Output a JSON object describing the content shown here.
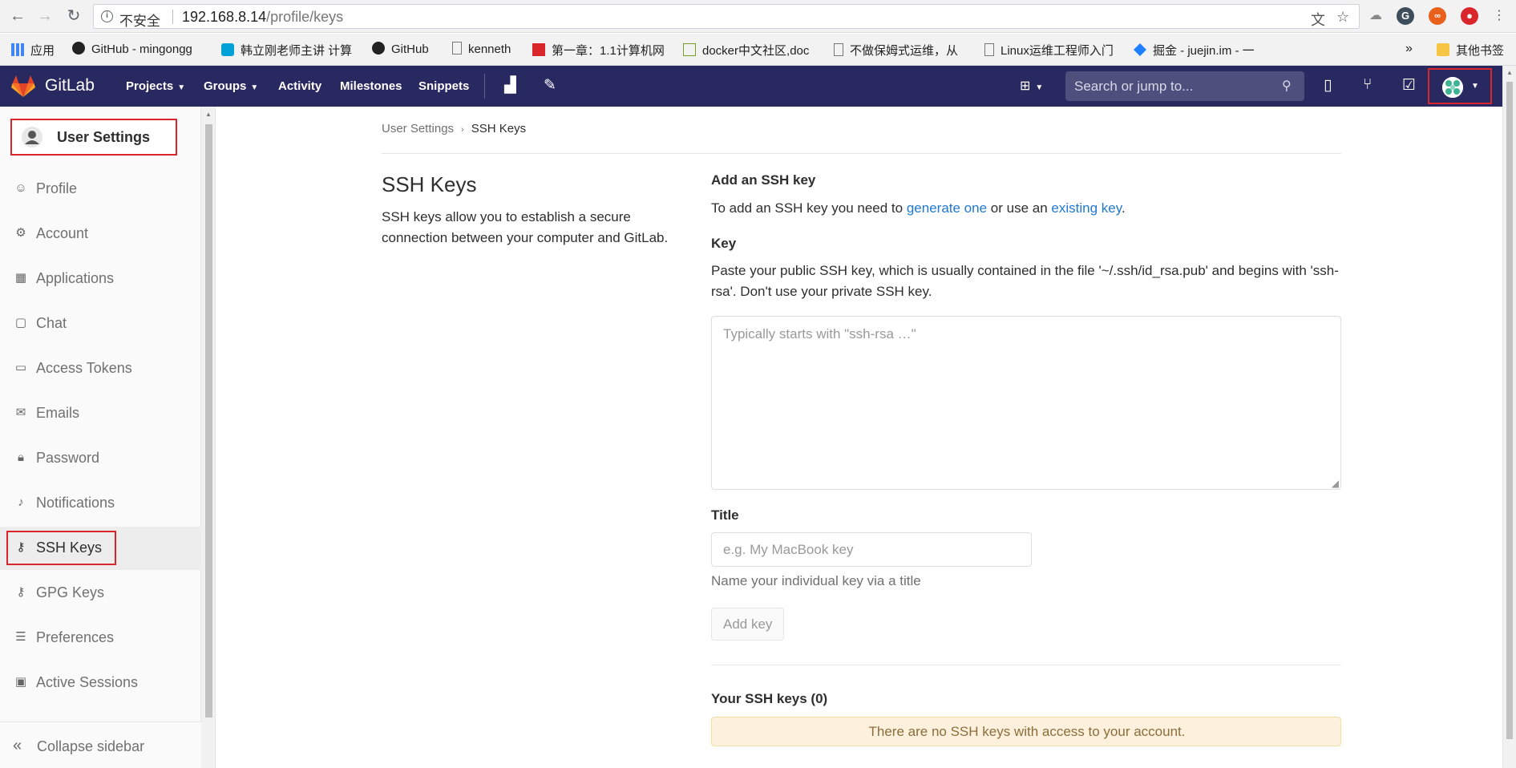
{
  "browser": {
    "insecure_label": "不安全",
    "url_host": "192.168.8.14",
    "url_path": "/profile/keys",
    "bookmarks": [
      {
        "label": "应用",
        "icon": "apps-grid-icon"
      },
      {
        "label": "GitHub - mingongg",
        "icon": "github-icon"
      },
      {
        "label": "韩立刚老师主讲 计算",
        "icon": "bilibili-icon"
      },
      {
        "label": "GitHub",
        "icon": "github-icon"
      },
      {
        "label": "kenneth",
        "icon": "page-icon"
      },
      {
        "label": "第一章：1.1计算机网",
        "icon": "csdn-icon"
      },
      {
        "label": "docker中文社区,doc",
        "icon": "edit-icon"
      },
      {
        "label": "不做保姆式运维，从",
        "icon": "page-icon"
      },
      {
        "label": "Linux运维工程师入门",
        "icon": "page-icon"
      },
      {
        "label": "掘金 - juejin.im - 一",
        "icon": "juejin-icon"
      }
    ],
    "more_bookmarks": "»",
    "other_bookmarks": "其他书签"
  },
  "header": {
    "brand": "GitLab",
    "nav": [
      {
        "label": "Projects",
        "dropdown": true
      },
      {
        "label": "Groups",
        "dropdown": true
      },
      {
        "label": "Activity",
        "dropdown": false
      },
      {
        "label": "Milestones",
        "dropdown": false
      },
      {
        "label": "Snippets",
        "dropdown": false
      }
    ],
    "search_placeholder": "Search or jump to..."
  },
  "sidebar": {
    "title": "User Settings",
    "items": [
      {
        "label": "Profile",
        "icon": "profile-icon",
        "active": false
      },
      {
        "label": "Account",
        "icon": "account-icon",
        "active": false
      },
      {
        "label": "Applications",
        "icon": "applications-icon",
        "active": false
      },
      {
        "label": "Chat",
        "icon": "chat-icon",
        "active": false
      },
      {
        "label": "Access Tokens",
        "icon": "access-tokens-icon",
        "active": false
      },
      {
        "label": "Emails",
        "icon": "emails-icon",
        "active": false
      },
      {
        "label": "Password",
        "icon": "lock-icon",
        "active": false
      },
      {
        "label": "Notifications",
        "icon": "bell-icon",
        "active": false
      },
      {
        "label": "SSH Keys",
        "icon": "key-icon",
        "active": true
      },
      {
        "label": "GPG Keys",
        "icon": "key-icon",
        "active": false
      },
      {
        "label": "Preferences",
        "icon": "sliders-icon",
        "active": false
      },
      {
        "label": "Active Sessions",
        "icon": "monitor-icon",
        "active": false
      }
    ],
    "collapse_label": "Collapse sidebar"
  },
  "breadcrumb": {
    "parent": "User Settings",
    "current": "SSH Keys"
  },
  "main": {
    "title": "SSH Keys",
    "description": "SSH keys allow you to establish a secure connection between your computer and GitLab.",
    "add_heading": "Add an SSH key",
    "add_text_prefix": "To add an SSH key you need to",
    "generate_link": "generate one",
    "add_text_middle": "or use an",
    "existing_link": "existing key",
    "add_text_suffix": ".",
    "key_label": "Key",
    "key_help": "Paste your public SSH key, which is usually contained in the file '~/.ssh/id_rsa.pub' and begins with 'ssh-rsa'. Don't use your private SSH key.",
    "key_placeholder": "Typically starts with \"ssh-rsa …\"",
    "title_label": "Title",
    "title_placeholder": "e.g. My MacBook key",
    "title_help": "Name your individual key via a title",
    "add_button": "Add key",
    "your_keys_heading": "Your SSH keys (0)",
    "no_keys_message": "There are no SSH keys with access to your account."
  },
  "colors": {
    "header_bg": "#292961",
    "link": "#1f78d1",
    "highlight_border": "#d9262c",
    "warning_bg": "#fdf1dd"
  }
}
